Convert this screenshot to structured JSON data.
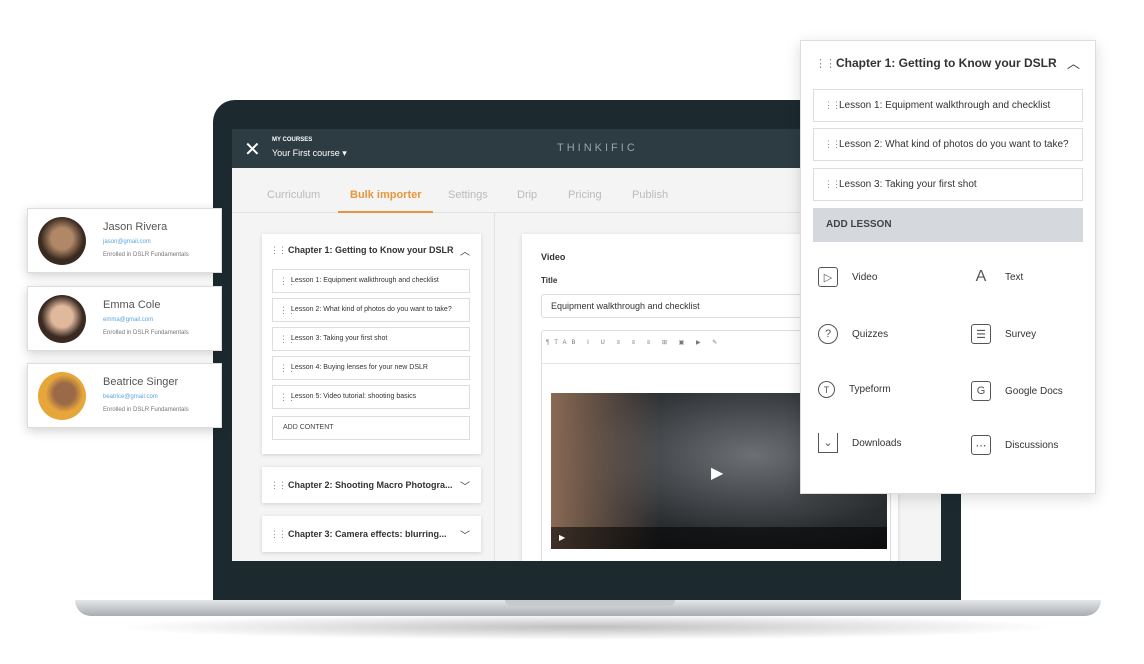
{
  "app": {
    "close_icon": "close-icon",
    "my_courses": "MY COURSES",
    "course": "Your First course",
    "brand": "THINKIFIC"
  },
  "tabs": [
    {
      "label": "Curriculum"
    },
    {
      "label": "Bulk importer",
      "active": true
    },
    {
      "label": "Settings"
    },
    {
      "label": "Drip"
    },
    {
      "label": "Pricing"
    },
    {
      "label": "Publish"
    }
  ],
  "accent": "#e8963b",
  "curriculum": {
    "chapter1": "Chapter 1: Getting to Know your DSLR",
    "lessons": [
      "Lesson 1: Equipment walkthrough and checklist",
      "Lesson 2: What kind of photos do you want to take?",
      "Lesson 3: Taking your first shot",
      "Lesson 4: Buying lenses for your new DSLR",
      "Lesson 5: Video tutorial: shooting basics"
    ],
    "add_content": "ADD CONTENT",
    "chapter2": "Chapter 2:  Shooting Macro Photogra...",
    "chapter3": "Chapter 3: Camera effects: blurring..."
  },
  "editor": {
    "heading": "Video",
    "title_label": "Title",
    "title_value": "Equipment walkthrough and checklist"
  },
  "panel": {
    "chapter": "Chapter 1: Getting to Know your DSLR",
    "lessons": [
      "Lesson 1: Equipment walkthrough and checklist",
      "Lesson 2: What kind of photos do you want to take?",
      "Lesson 3: Taking your first shot"
    ],
    "add_lesson": "ADD LESSON",
    "types": [
      {
        "label": "Video",
        "icon": "video-icon"
      },
      {
        "label": "Text",
        "icon": "text-icon"
      },
      {
        "label": "Quizzes",
        "icon": "quiz-icon"
      },
      {
        "label": "Survey",
        "icon": "survey-icon"
      },
      {
        "label": "Typeform",
        "icon": "typeform-icon"
      },
      {
        "label": "Google Docs",
        "icon": "google-docs-icon"
      },
      {
        "label": "Downloads",
        "icon": "downloads-icon"
      },
      {
        "label": "Discussions",
        "icon": "discussions-icon"
      }
    ]
  },
  "users": [
    {
      "name": "Jason Rivera",
      "email": "jason@gmail.com",
      "enrolled": "Enrolled in DSLR Fundamentals"
    },
    {
      "name": "Emma Cole",
      "email": "emma@gmail.com",
      "enrolled": "Enrolled in DSLR Fundamentals"
    },
    {
      "name": "Beatrice Singer",
      "email": "beatrice@gmail.com",
      "enrolled": "Enrolled in DSLR Fundamentals"
    }
  ]
}
